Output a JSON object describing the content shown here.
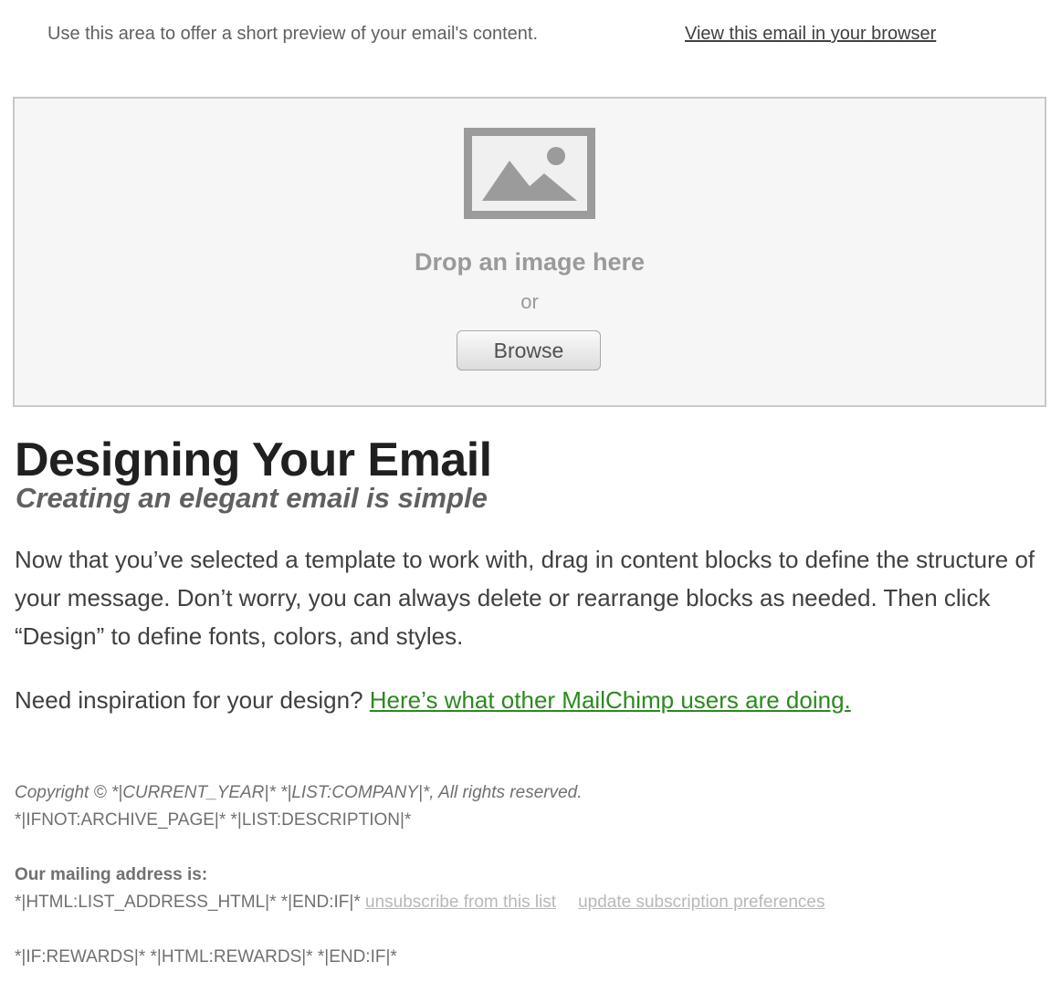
{
  "preheader": {
    "preview_text": "Use this area to offer a short preview of your email's content.",
    "view_in_browser": "View this email in your browser"
  },
  "image_block": {
    "icon": "image-placeholder-icon",
    "drop_label": "Drop an image here",
    "or_label": "or",
    "browse_label": "Browse"
  },
  "content": {
    "title": "Designing Your Email",
    "subtitle": "Creating an elegant email is simple",
    "body": "Now that you’ve selected a template to work with, drag in content blocks to define the structure of your message. Don’t worry, you can always delete or rearrange blocks as needed. Then click “Design” to define fonts, colors, and styles.",
    "inspiration_prefix": "Need inspiration for your design? ",
    "inspiration_link": "Here’s what other MailChimp users are doing."
  },
  "footer": {
    "copyright": "Copyright © *|CURRENT_YEAR|* *|LIST:COMPANY|*, All rights reserved.",
    "description": "*|IFNOT:ARCHIVE_PAGE|* *|LIST:DESCRIPTION|*",
    "address_heading": "Our mailing address is:",
    "address_merge": "*|HTML:LIST_ADDRESS_HTML|* *|END:IF|* ",
    "unsubscribe": "unsubscribe from this list",
    "update_prefs": "update subscription preferences",
    "rewards": "*|IF:REWARDS|* *|HTML:REWARDS|* *|END:IF|*"
  },
  "colors": {
    "link_green": "#2b8a1e",
    "muted_link": "#b8b8b8",
    "dropzone_bg": "#f6f6f6",
    "placeholder_gray": "#9b9b9b"
  }
}
